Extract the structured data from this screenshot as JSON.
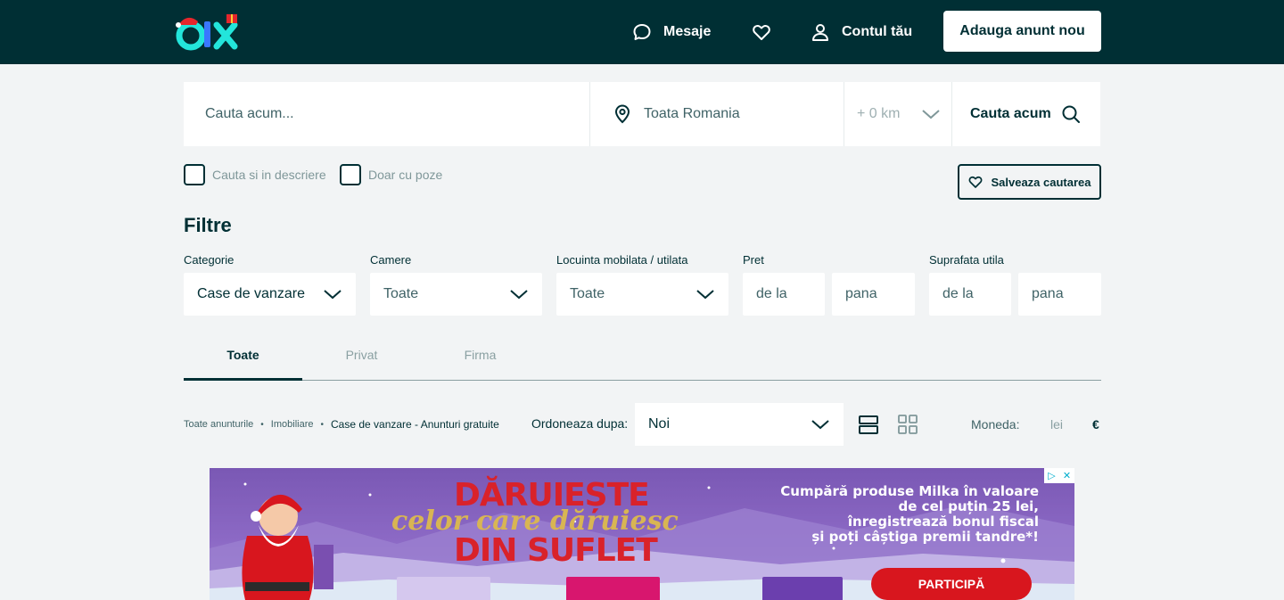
{
  "header": {
    "logo_alt": "OLX",
    "messages_label": "Mesaje",
    "account_label": "Contul tău",
    "post_ad_label": "Adauga anunt nou"
  },
  "search": {
    "query_placeholder": "Cauta acum...",
    "location_value": "Toata Romania",
    "radius_value": "+ 0 km",
    "button_label": "Cauta acum"
  },
  "options": {
    "search_description_label": "Cauta si in descriere",
    "photos_only_label": "Doar cu poze",
    "save_search_label": "Salveaza cautarea"
  },
  "filters": {
    "title": "Filtre",
    "category": {
      "label": "Categorie",
      "value": "Case de vanzare"
    },
    "rooms": {
      "label": "Camere",
      "value": "Toate"
    },
    "furnished": {
      "label": "Locuinta mobilata / utilata",
      "value": "Toate"
    },
    "price": {
      "label": "Pret",
      "from_placeholder": "de la",
      "to_placeholder": "pana"
    },
    "area": {
      "label": "Suprafata utila",
      "from_placeholder": "de la",
      "to_placeholder": "pana"
    }
  },
  "tabs": [
    {
      "label": "Toate",
      "active": true
    },
    {
      "label": "Privat",
      "active": false
    },
    {
      "label": "Firma",
      "active": false
    }
  ],
  "breadcrumb": [
    "Toate anunturile",
    "Imobiliare",
    "Case de vanzare - Anunturi gratuite"
  ],
  "sort": {
    "label": "Ordoneaza dupa:",
    "value": "Noi"
  },
  "currency": {
    "label": "Moneda:",
    "options": [
      "lei",
      "€"
    ],
    "selected": "€"
  },
  "ad_banner": {
    "headline_1": "DĂRUIEȘTE",
    "headline_2": "celor care dăruiesc",
    "headline_3": "DIN SUFLET",
    "body_lines": [
      "Cumpără produse Milka în valoare",
      "de cel puțin 25 lei,",
      "înregistrează bonul fiscal",
      "și poți câștiga premii tandre*!"
    ],
    "cta": "PARTICIPĂ",
    "adchoices_icon": "▷",
    "close_icon": "✕"
  },
  "colors": {
    "brand_dark": "#002f34",
    "background": "#f2f4f5",
    "ad_purple": "#7a58b4",
    "ad_red": "#d9222a"
  }
}
